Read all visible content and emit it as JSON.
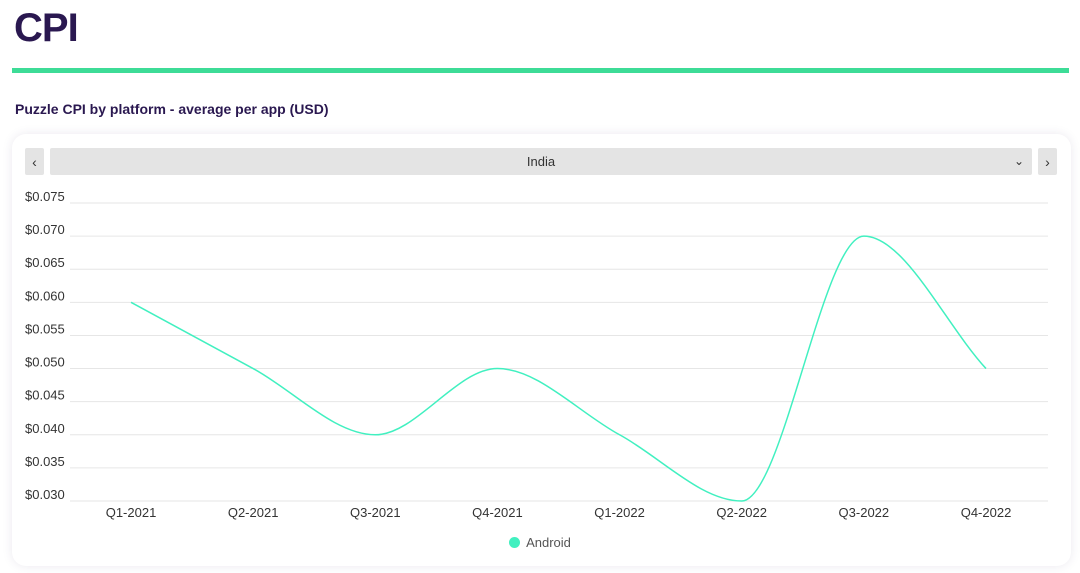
{
  "page": {
    "title": "CPI"
  },
  "chart_heading": "Puzzle CPI by platform - average per app (USD)",
  "selector": {
    "prev_icon": "‹",
    "next_icon": "›",
    "value": "India",
    "chevron_icon": "⌄"
  },
  "colors": {
    "accent": "#3ddc97",
    "line": "#41f0c0",
    "grid": "#e6e6e6",
    "axis_text": "#333333"
  },
  "chart_data": {
    "type": "line",
    "categories": [
      "Q1-2021",
      "Q2-2021",
      "Q3-2021",
      "Q4-2021",
      "Q1-2022",
      "Q2-2022",
      "Q3-2022",
      "Q4-2022"
    ],
    "series": [
      {
        "name": "Android",
        "values": [
          0.06,
          0.05,
          0.04,
          0.05,
          0.04,
          0.03,
          0.07,
          0.05
        ],
        "color": "#41f0c0"
      }
    ],
    "y_ticks": [
      "$0.030",
      "$0.035",
      "$0.040",
      "$0.045",
      "$0.050",
      "$0.055",
      "$0.060",
      "$0.065",
      "$0.070",
      "$0.075"
    ],
    "ylim": [
      0.03,
      0.075
    ],
    "grid": true,
    "legend_position": "bottom"
  }
}
